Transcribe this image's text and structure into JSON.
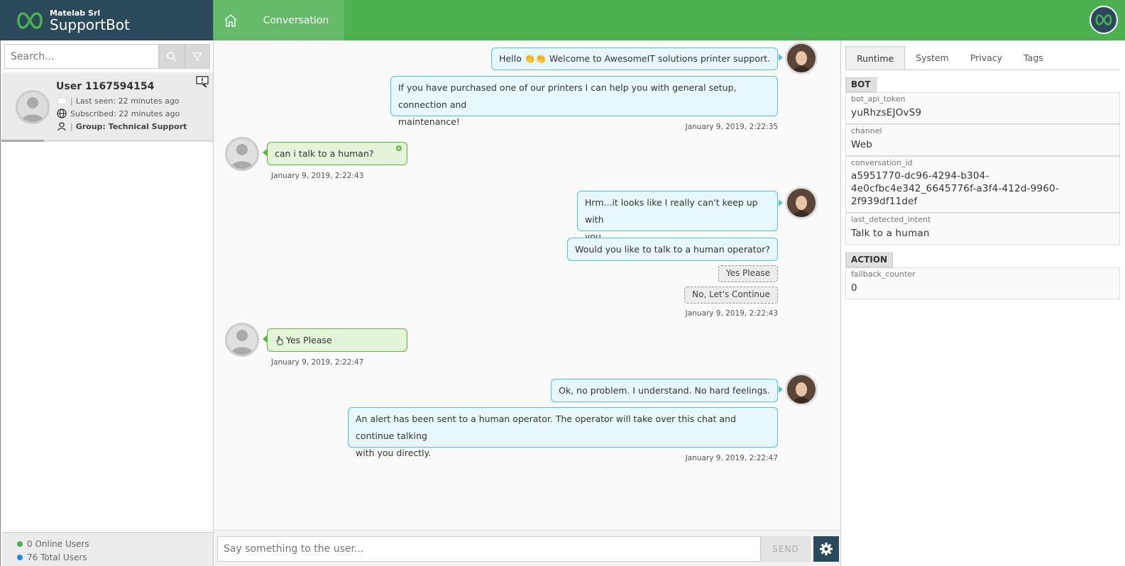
{
  "app": {
    "company": "Matelab Srl",
    "name": "SupportBot"
  },
  "nav": {
    "conversation_tab": "Conversation"
  },
  "sidebar": {
    "search_placeholder": "Search...",
    "user": {
      "name": "User 1167594154",
      "last_seen": "Last seen: 22 minutes ago",
      "subscribed": "Subscribed: 22 minutes ago",
      "group": "Group: Technical Support"
    },
    "footer": {
      "online": "0 Online Users",
      "total": "76 Total Users",
      "online_color": "#4caf50",
      "total_color": "#1e88e5"
    }
  },
  "chat": {
    "messages": [
      {
        "from": "bot",
        "text": "Hello 👏👏 Welcome to AwesomeIT solutions printer support."
      },
      {
        "from": "bot",
        "text_line1": "If you have purchased one of our printers I can help you with general setup, connection and",
        "text_line2": "maintenance!"
      },
      {
        "from": "bot",
        "timestamp": "January 9, 2019, 2:22:35"
      },
      {
        "from": "user",
        "text": "can i talk to a human?",
        "timestamp": "January 9, 2019, 2:22:43"
      },
      {
        "from": "bot",
        "text_line1": "Hrm...it looks like I really can't keep up with",
        "text_line2": "you."
      },
      {
        "from": "bot",
        "text": "Would you like to talk to a human operator?"
      },
      {
        "from": "bot",
        "options": [
          "Yes Please",
          "No, Let's Continue"
        ],
        "timestamp": "January 9, 2019, 2:22:43"
      },
      {
        "from": "user",
        "text": "Yes Please",
        "timestamp": "January 9, 2019, 2:22:47"
      },
      {
        "from": "bot",
        "text": "Ok, no problem. I understand. No hard feelings."
      },
      {
        "from": "bot",
        "text_line1": "An alert has been sent to a human operator. The operator will take over this chat and continue talking",
        "text_line2": "with you directly.",
        "timestamp": "January 9, 2019, 2:22:47"
      }
    ],
    "input_placeholder": "Say something to the user...",
    "send_label": "SEND"
  },
  "right_panel": {
    "tabs": [
      "Runtime",
      "System",
      "Privacy",
      "Tags"
    ],
    "active_tab": "Runtime",
    "bot_header": "BOT",
    "bot_vars": [
      {
        "key": "bot_api_token",
        "value": "yuRhzsEJOvS9"
      },
      {
        "key": "channel",
        "value": "Web"
      },
      {
        "key": "conversation_id",
        "value_line1": "a5951770-dc96-4294-b304-",
        "value_line2": "4e0cfbc4e342_6645776f-a3f4-412d-9960-",
        "value_line3": "2f939df11def"
      },
      {
        "key": "last_detected_intent",
        "value": "Talk to a human"
      }
    ],
    "action_header": "ACTION",
    "action_vars": [
      {
        "key": "fallback_counter",
        "value": "0"
      }
    ]
  },
  "colors": {
    "header_green": "#4caf50",
    "brand_dark": "#2a4a5c",
    "bot_bubble_border": "#4fc3e8",
    "user_bubble_border": "#5cb23a"
  }
}
